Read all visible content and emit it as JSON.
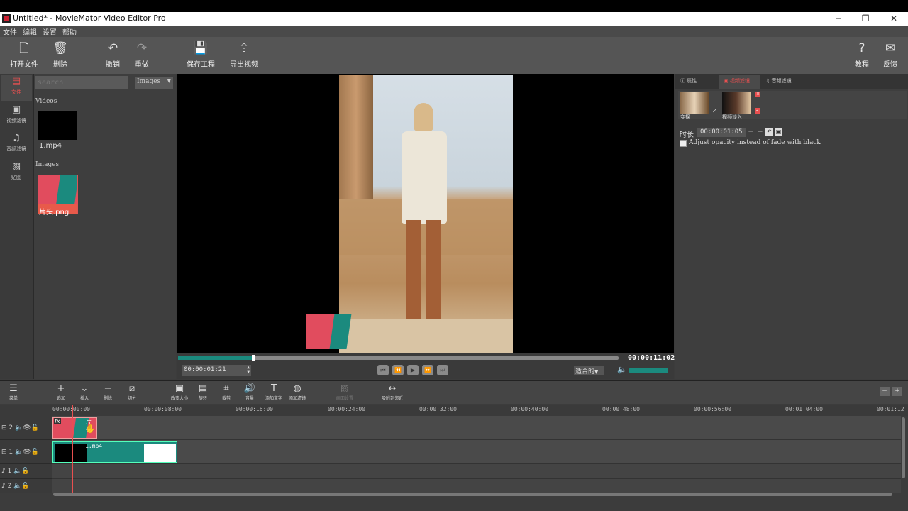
{
  "window": {
    "title": "Untitled* - MovieMator Video Editor Pro",
    "minimize": "─",
    "maximize": "❐",
    "close": "✕"
  },
  "menu": [
    "文件",
    "编辑",
    "设置",
    "帮助"
  ],
  "toolbar": {
    "open": "打开文件",
    "delete": "删除",
    "undo": "撤销",
    "redo": "重做",
    "save": "保存工程",
    "export": "导出视频",
    "tutorial": "教程",
    "feedback": "反馈"
  },
  "sidebar": {
    "items": [
      {
        "label": "文件",
        "icon": "file-icon",
        "active": true
      },
      {
        "label": "视频滤镜",
        "icon": "video-filter-icon"
      },
      {
        "label": "音频滤镜",
        "icon": "audio-filter-icon"
      },
      {
        "label": "贴图",
        "icon": "sticker-icon"
      }
    ]
  },
  "library": {
    "search_placeholder": "search",
    "filter": "Images",
    "videos_label": "Videos",
    "video_file": "1.mp4",
    "images_label": "Images",
    "image_file": "片头.png"
  },
  "player": {
    "current_time": "00:00:01:21",
    "total_time": "00:00:11:02",
    "zoom": "适合的",
    "progress": 0.17,
    "volume": 0.95
  },
  "properties": {
    "tabs": [
      "属性",
      "视频滤镜",
      "音频滤镜"
    ],
    "active_tab": 1,
    "filters": [
      {
        "label": "变换"
      },
      {
        "label": "视频淡入"
      }
    ],
    "duration_label": "时长",
    "duration_value": "00:00:01:05",
    "checkbox_label": "Adjust opacity instead of fade with black",
    "checkbox_checked": false
  },
  "timeline_toolbar": {
    "menu": "菜单",
    "append": "追加",
    "insert": "插入",
    "remove": "删除",
    "split": "切分",
    "resize": "改变大小",
    "rotate": "旋转",
    "crop": "裁剪",
    "volume": "音量",
    "add_text": "添加文字",
    "add_filter": "添加滤镜",
    "picture": "画面设置",
    "snap": "吸附到邻近"
  },
  "ruler": [
    "00:00:00:00",
    "00:00:08:00",
    "00:00:16:00",
    "00:00:24:00",
    "00:00:32:00",
    "00:00:40:00",
    "00:00:48:00",
    "00:00:56:00",
    "00:01:04:00",
    "00:01:12"
  ],
  "tracks": [
    {
      "name": "2",
      "type": "video",
      "clip": "片头"
    },
    {
      "name": "1",
      "type": "video",
      "clip": "1.mp4"
    },
    {
      "name": "1",
      "type": "audio"
    },
    {
      "name": "2",
      "type": "audio"
    }
  ],
  "colors": {
    "accent": "#1b8a7e",
    "brand": "#e14c5e"
  }
}
